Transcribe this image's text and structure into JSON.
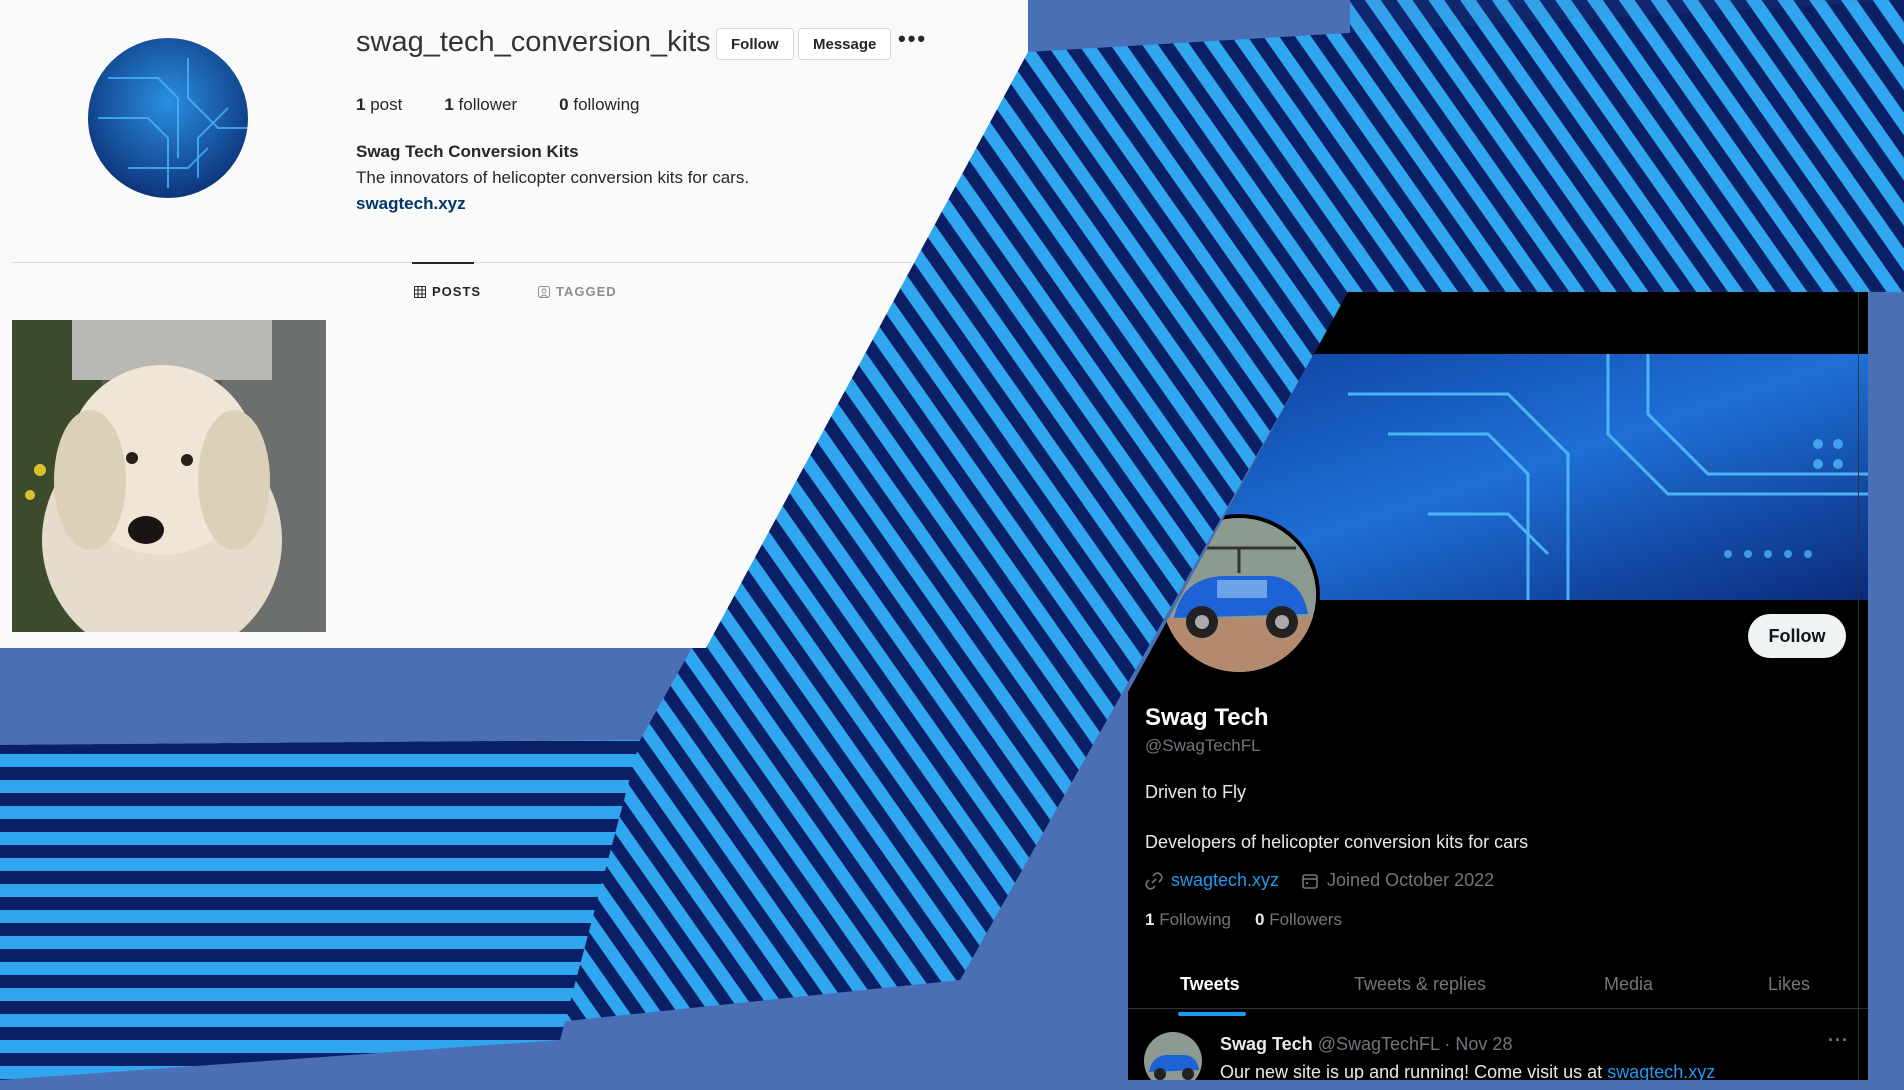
{
  "colors": {
    "background": "#4a6fb5",
    "stripe_dark": "#0a1f66",
    "stripe_light": "#2fa6ee",
    "twitter_blue": "#1d9bf0",
    "instagram_link": "#00376b"
  },
  "instagram": {
    "avatar_icon": "circuit-board-avatar-icon",
    "username": "swag_tech_conversion_kits",
    "follow_label": "Follow",
    "message_label": "Message",
    "more_label": "•••",
    "stats": {
      "posts_count": "1",
      "posts_label": "post",
      "followers_count": "1",
      "followers_label": "follower",
      "following_count": "0",
      "following_label": "following"
    },
    "full_name": "Swag Tech Conversion Kits",
    "bio": "The innovators of helicopter conversion kits for cars.",
    "website": "swagtech.xyz",
    "tabs": [
      {
        "label": "POSTS",
        "icon": "grid-icon"
      },
      {
        "label": "TAGGED",
        "icon": "tagged-icon"
      }
    ],
    "post_image": "fluffy-white-dog-photo"
  },
  "twitter": {
    "banner_image": "blue-circuit-board-banner",
    "avatar_image": "blue-car-with-rotor-photo",
    "follow_label": "Follow",
    "display_name": "Swag Tech",
    "handle": "@SwagTechFL",
    "motto": "Driven to Fly",
    "bio": "Developers of helicopter conversion kits for cars",
    "website": "swagtech.xyz",
    "joined": "Joined October 2022",
    "following_count": "1",
    "following_label": "Following",
    "followers_count": "0",
    "followers_label": "Followers",
    "tabs": [
      "Tweets",
      "Tweets & replies",
      "Media",
      "Likes"
    ],
    "tweet": {
      "author": "Swag Tech",
      "handle": "@SwagTechFL",
      "separator": "·",
      "date": "Nov 28",
      "text": "Our new site is up and running! Come visit us at ",
      "link": "swagtech.xyz",
      "more_label": "···"
    }
  }
}
